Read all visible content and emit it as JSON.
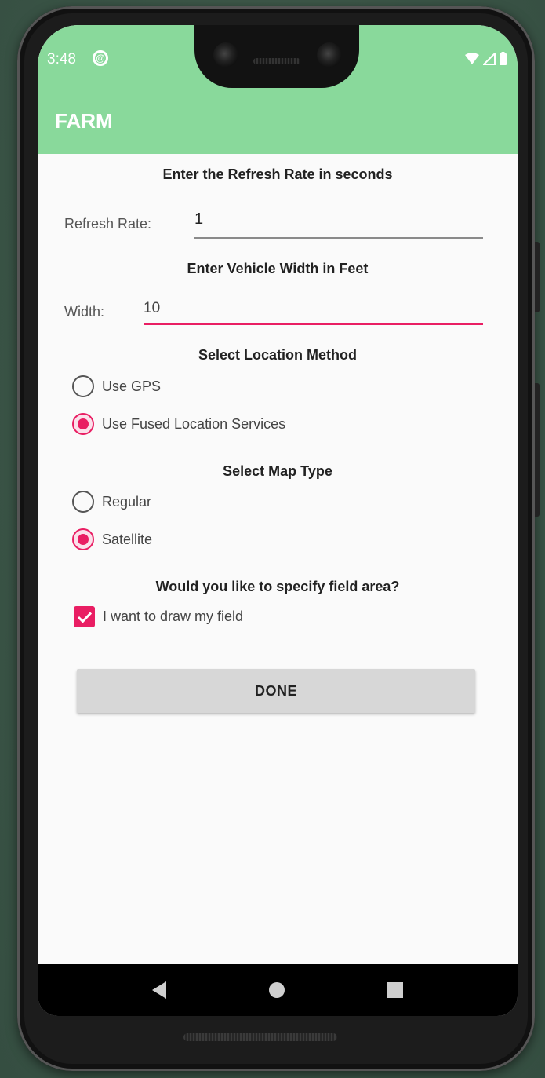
{
  "status_bar": {
    "time": "3:48",
    "sync_icon": "at-sign-icon",
    "icons": [
      "wifi-icon",
      "signal-icon",
      "battery-icon"
    ]
  },
  "app_bar": {
    "title": "FARM",
    "color": "#89d99b"
  },
  "refresh": {
    "heading": "Enter the Refresh Rate in seconds",
    "label": "Refresh Rate:",
    "value": "1"
  },
  "width": {
    "heading": "Enter Vehicle Width in Feet",
    "label": "Width:",
    "value": "10"
  },
  "location": {
    "heading": "Select Location Method",
    "options": [
      {
        "label": "Use GPS",
        "checked": false
      },
      {
        "label": "Use Fused Location Services",
        "checked": true
      }
    ]
  },
  "map_type": {
    "heading": "Select Map Type",
    "options": [
      {
        "label": "Regular",
        "checked": false
      },
      {
        "label": "Satellite",
        "checked": true
      }
    ]
  },
  "field_area": {
    "heading": "Would you like to specify field area?",
    "checkbox_label": "I want to draw my field",
    "checked": true
  },
  "done_button": {
    "label": "DONE"
  },
  "accent_color": "#e91e63",
  "nav": {
    "icons": [
      "back-icon",
      "home-icon",
      "recents-icon"
    ]
  }
}
